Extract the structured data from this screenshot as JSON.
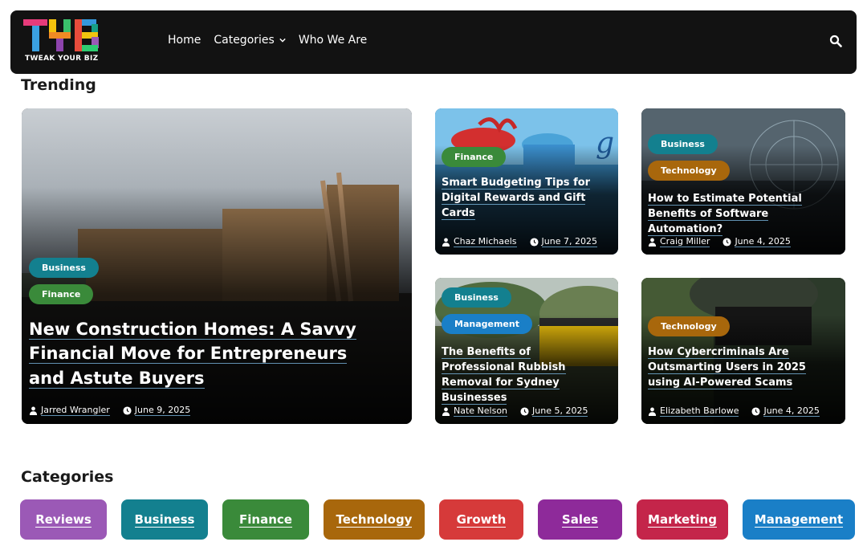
{
  "header": {
    "logo_text": "TWEAK YOUR BIZ",
    "nav": [
      {
        "label": "Home"
      },
      {
        "label": "Categories"
      },
      {
        "label": "Who We Are"
      }
    ]
  },
  "trending": {
    "title": "Trending",
    "featured": {
      "badges": [
        "Business",
        "Finance"
      ],
      "title": "New Construction Homes: A Savvy Financial Move for Entrepreneurs and Astute Buyers",
      "author": "Jarred Wrangler",
      "date": "June 9, 2025"
    },
    "cards": [
      {
        "badges": [
          "Finance"
        ],
        "title": "Smart Budgeting Tips for Digital Rewards and Gift Cards",
        "author": "Chaz Michaels",
        "date": "June 7, 2025"
      },
      {
        "badges": [
          "Business",
          "Technology"
        ],
        "title": "How to Estimate Potential Benefits of Software Automation?",
        "author": "Craig Miller",
        "date": "June 4, 2025"
      },
      {
        "badges": [
          "Business",
          "Management"
        ],
        "title": "The Benefits of Professional Rubbish Removal for Sydney Businesses",
        "author": "Nate Nelson",
        "date": "June 5, 2025"
      },
      {
        "badges": [
          "Technology"
        ],
        "title": "How Cybercriminals Are Outsmarting Users in 2025 using AI-Powered Scams",
        "author": "Elizabeth Barlowe",
        "date": "June 4, 2025"
      }
    ]
  },
  "categories": {
    "title": "Categories",
    "items": [
      {
        "label": "Reviews",
        "color": "#9b59b6"
      },
      {
        "label": "Business",
        "color": "#13808f"
      },
      {
        "label": "Finance",
        "color": "#3a8a3a"
      },
      {
        "label": "Technology",
        "color": "#a8670c"
      },
      {
        "label": "Growth",
        "color": "#d63a3a"
      },
      {
        "label": "Sales",
        "color": "#8e2a9a"
      },
      {
        "label": "Marketing",
        "color": "#c4254a"
      },
      {
        "label": "Management",
        "color": "#1a7fc7"
      }
    ]
  },
  "colors": {
    "Business": "#13808f",
    "Finance": "#3a8a3a",
    "Technology": "#a8670c",
    "Management": "#1a7fc7"
  }
}
